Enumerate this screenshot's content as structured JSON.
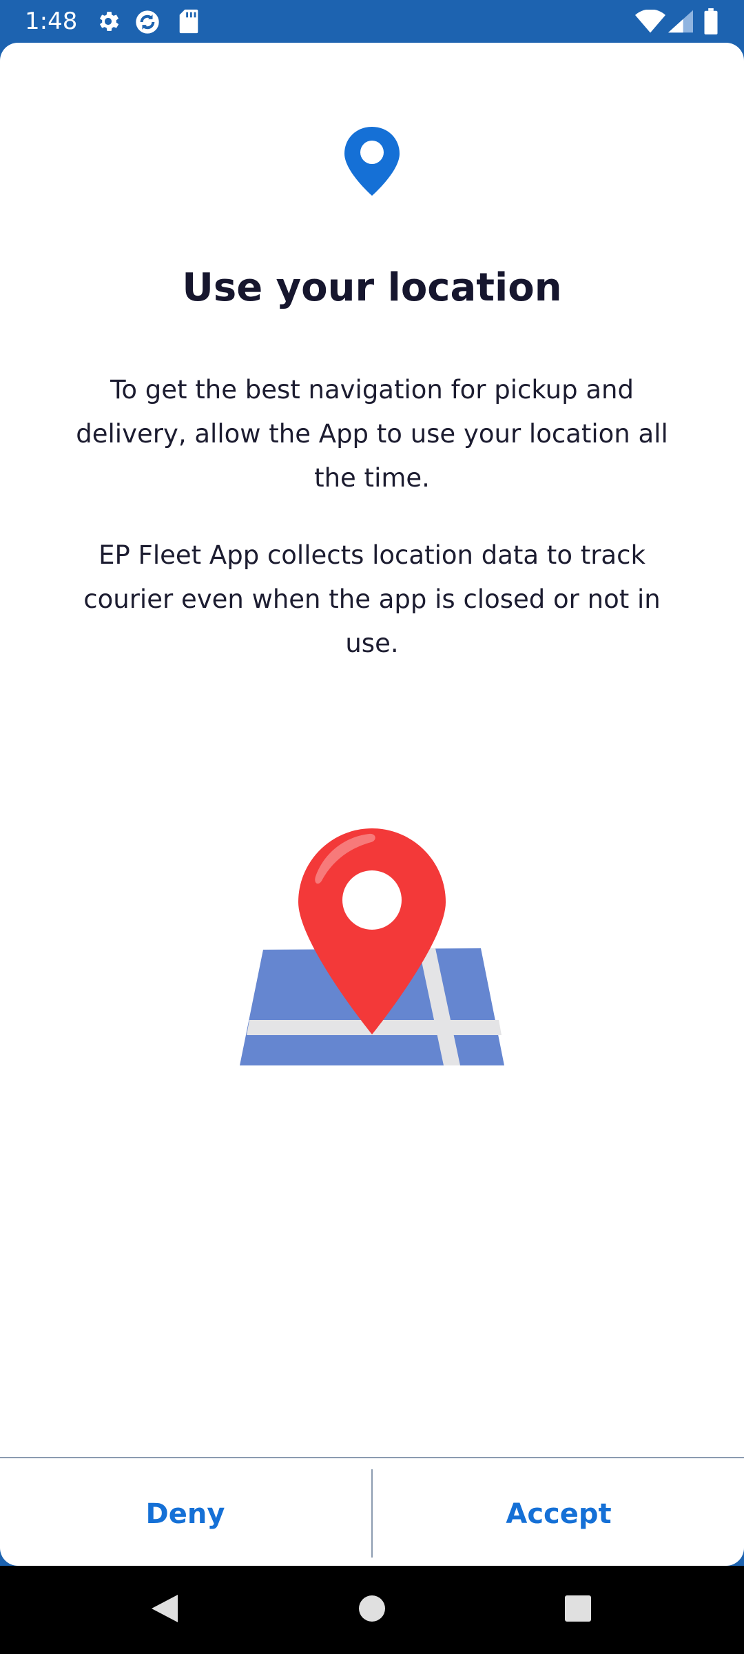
{
  "status_bar": {
    "time": "1:48",
    "icons_left": [
      "settings-icon",
      "sync-icon",
      "sd-card-icon"
    ],
    "icons_right": [
      "wifi-icon",
      "cellular-signal-icon",
      "battery-icon"
    ]
  },
  "dialog": {
    "top_icon": "location-pin-icon",
    "title": "Use your location",
    "paragraph_1": "To get the best navigation for pickup and delivery, allow the App to use your location all the time.",
    "paragraph_2": "EP Fleet App collects location data to track courier even when the app is closed or not in use.",
    "illustration": "map-pin-illustration",
    "buttons": {
      "deny_label": "Deny",
      "accept_label": "Accept"
    }
  },
  "colors": {
    "accent": "#1570D6",
    "status_bar": "#1D63B0",
    "pin_red": "#F23A3A",
    "map_blue": "#6586D0"
  },
  "nav_bar": {
    "buttons": [
      "back-icon",
      "home-icon",
      "recents-icon"
    ]
  }
}
